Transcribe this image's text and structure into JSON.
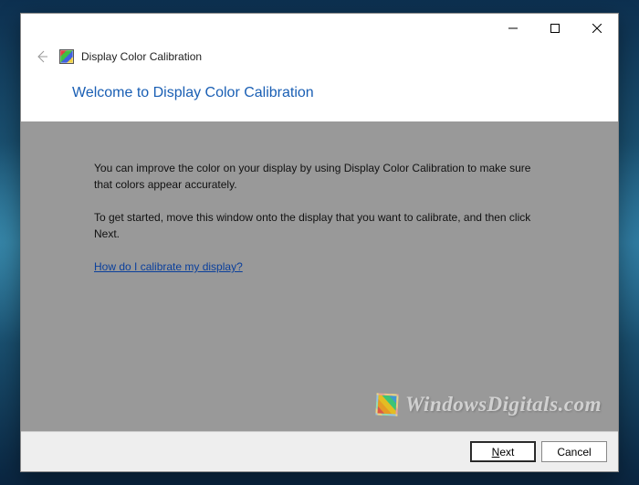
{
  "window": {
    "title": "Display Color Calibration"
  },
  "heading": "Welcome to Display Color Calibration",
  "content": {
    "para1": "You can improve the color on your display by using Display Color Calibration to make sure that colors appear accurately.",
    "para2": "To get started, move this window onto the display that you want to calibrate, and then click Next.",
    "helpLink": "How do I calibrate my display?"
  },
  "footer": {
    "next": "Next",
    "cancel": "Cancel"
  },
  "watermark": "WindowsDigitals.com"
}
